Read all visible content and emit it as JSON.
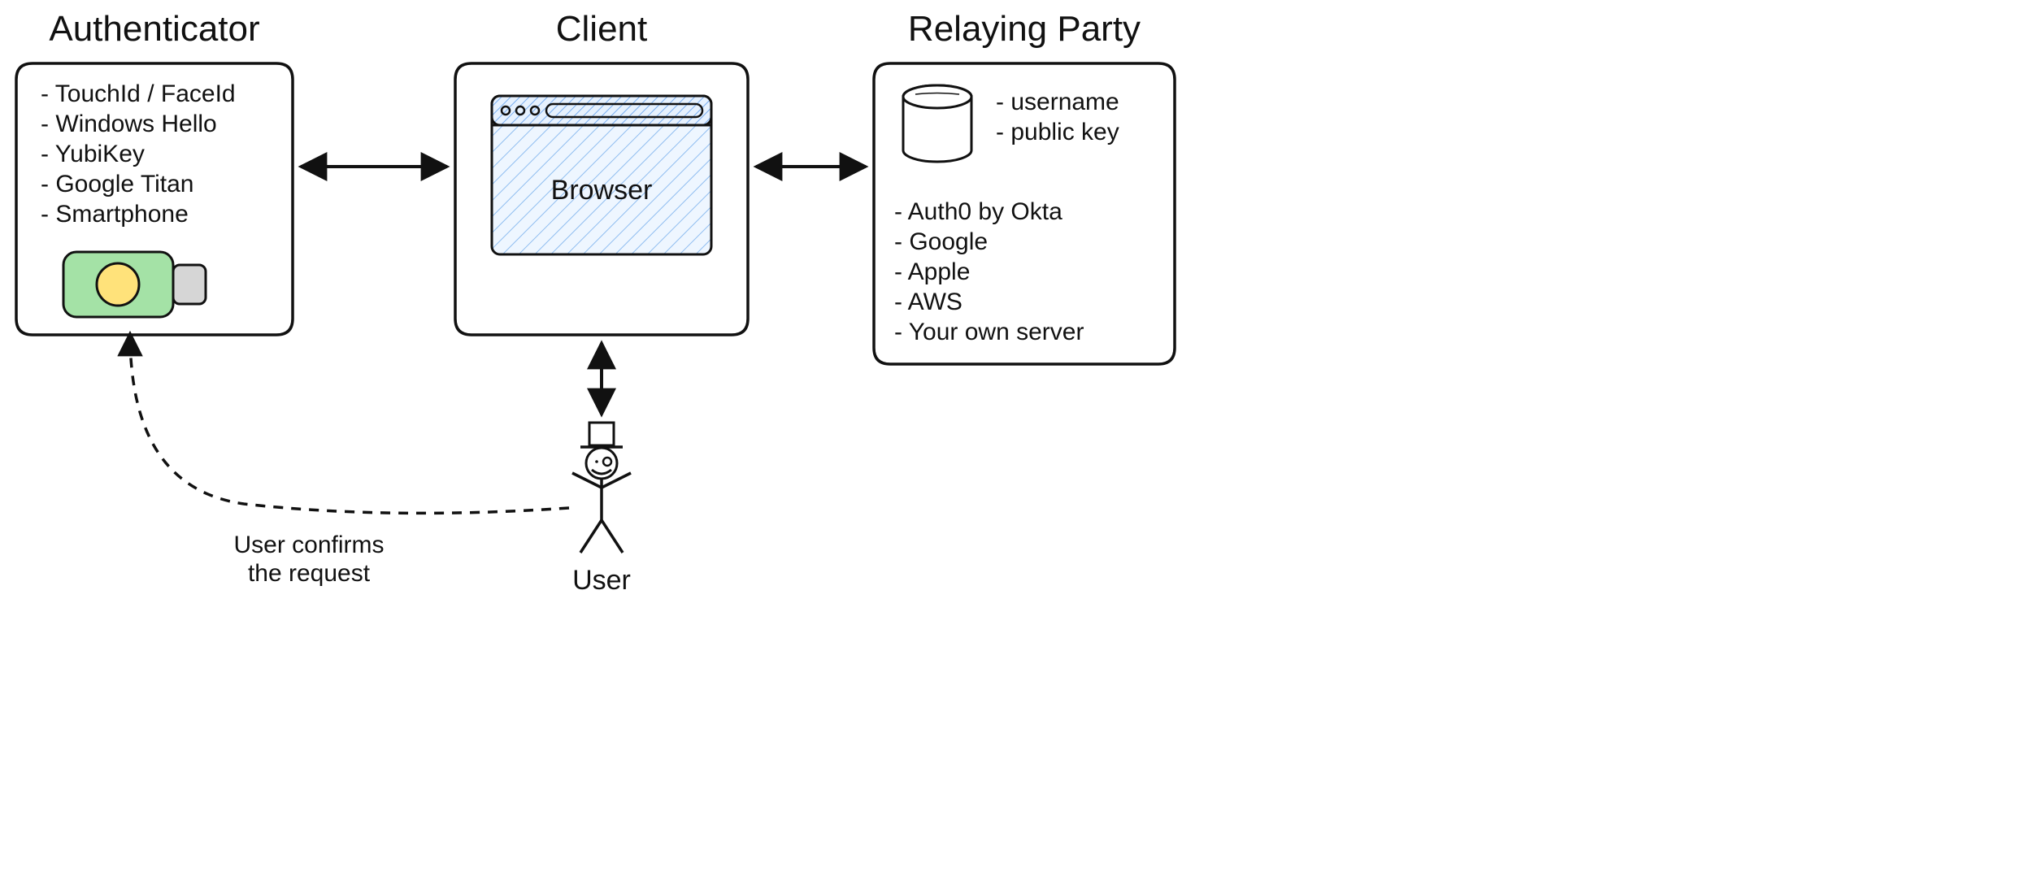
{
  "authenticator": {
    "title": "Authenticator",
    "items": [
      "TouchId / FaceId",
      "Windows Hello",
      "YubiKey",
      "Google Titan",
      "Smartphone"
    ]
  },
  "client": {
    "title": "Client",
    "browser_label": "Browser"
  },
  "relying_party": {
    "title": "Relaying Party",
    "stored": [
      "username",
      "public key"
    ],
    "providers": [
      "Auth0 by Okta",
      "Google",
      "Apple",
      "AWS",
      "Your own server"
    ]
  },
  "user": {
    "label": "User",
    "confirm_line1": "User confirms",
    "confirm_line2": "the request"
  }
}
